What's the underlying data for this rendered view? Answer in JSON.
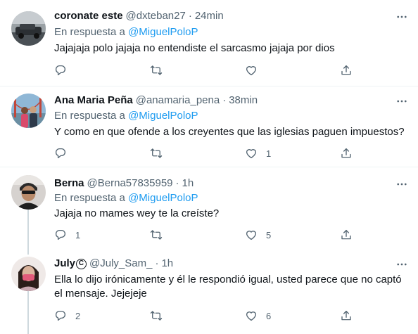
{
  "tweets": [
    {
      "name": "coronate este",
      "handle": "@dxteban27",
      "time": "24min",
      "replying_prefix": "En respuesta a ",
      "replying_to": "@MiguelPoloP",
      "text": "Jajajaja polo jajaja no entendiste el sarcasmo jajaja por dios",
      "reply_count": "",
      "retweet_count": "",
      "like_count": ""
    },
    {
      "name": "Ana Maria Peña",
      "handle": "@anamaria_pena",
      "time": "38min",
      "replying_prefix": "En respuesta a ",
      "replying_to": "@MiguelPoloP",
      "text": "Y como en que ofende a los creyentes que las iglesias paguen impuestos?",
      "reply_count": "",
      "retweet_count": "",
      "like_count": "1"
    },
    {
      "name": "Berna",
      "handle": "@Berna57835959",
      "time": "1h",
      "replying_prefix": "En respuesta a ",
      "replying_to": "@MiguelPoloP",
      "text": "Jajaja no mames wey te la creíste?",
      "reply_count": "1",
      "retweet_count": "",
      "like_count": "5"
    },
    {
      "name": "July",
      "name_badge": "C",
      "handle": "@July_Sam_",
      "time": "1h",
      "text": "Ella lo dijo irónicamente y él le respondió igual, usted parece que no captó el mensaje. Jejejeje",
      "reply_count": "2",
      "retweet_count": "",
      "like_count": "6"
    }
  ],
  "separator": "·",
  "colors": {
    "text_primary": "#0f1419",
    "text_secondary": "#536471",
    "link": "#1d9bf0",
    "divider": "#eff3f4",
    "thread_line": "#cfd9de"
  },
  "icons": {
    "reply": "reply-icon",
    "retweet": "retweet-icon",
    "like": "heart-icon",
    "share": "share-icon",
    "more": "more-icon"
  }
}
